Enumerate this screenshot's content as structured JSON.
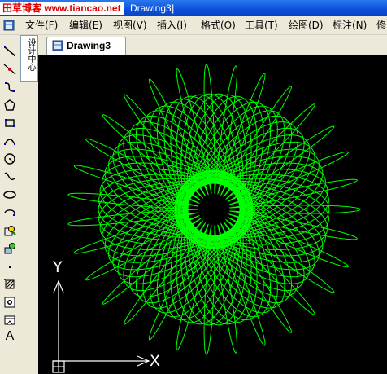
{
  "window": {
    "title_watermark": "田草博客 www.tiancao.net",
    "title_rest": "Drawing3]"
  },
  "menubar": {
    "items": [
      "文件(F)",
      "编辑(E)",
      "视图(V)",
      "插入(I)",
      "格式(O)",
      "工具(T)",
      "绘图(D)",
      "标注(N)",
      "修"
    ]
  },
  "side_panel": {
    "tab_label": "设计中心"
  },
  "document_tab": {
    "label": "Drawing3"
  },
  "toolbar": {
    "tools": [
      "line-icon",
      "construction-line-icon",
      "polyline-icon",
      "polygon-icon",
      "rectangle-icon",
      "arc-icon",
      "circle-icon",
      "spline-icon",
      "ellipse-icon",
      "ellipse-arc-icon",
      "insert-block-icon",
      "make-block-icon",
      "point-icon",
      "hatch-icon",
      "region-icon",
      "table-icon",
      "multiline-text-icon"
    ],
    "text_tool_glyph": "A"
  },
  "canvas": {
    "background": "#000000",
    "curve_color": "#00ff00",
    "ucs_x_label": "X",
    "ucs_y_label": "Y"
  },
  "colors": {
    "titlebar": "#0a4fd8",
    "watermark_text": "#e00000",
    "chrome": "#ece9d8"
  }
}
